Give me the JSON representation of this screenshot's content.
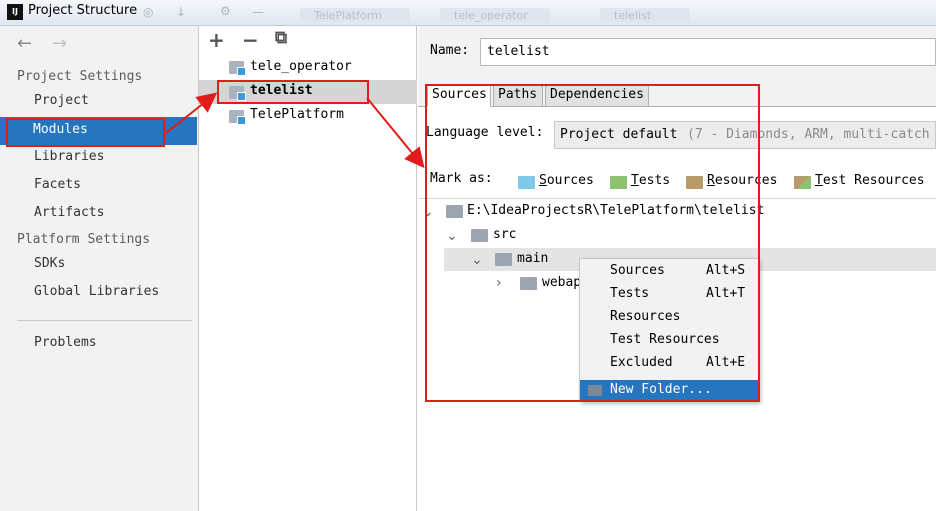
{
  "window": {
    "title": "Project Structure",
    "app_icon": "IJ",
    "ghost_tabs": [
      "TelePlatform",
      "tele_operator",
      "telelist"
    ]
  },
  "nav": {
    "back": "←",
    "forward": "→",
    "project_settings_header": "Project Settings",
    "items": [
      "Project",
      "Modules",
      "Libraries",
      "Facets",
      "Artifacts"
    ],
    "platform_settings_header": "Platform Settings",
    "platform_items": [
      "SDKs",
      "Global Libraries"
    ],
    "problems": "Problems"
  },
  "modules": {
    "add": "+",
    "remove": "−",
    "copy": "⧉",
    "list": [
      "tele_operator",
      "telelist",
      "TelePlatform"
    ]
  },
  "detail": {
    "name_label": "Name:",
    "name_value": "telelist",
    "tabs": [
      "Sources",
      "Paths",
      "Dependencies"
    ],
    "language_label": "Language level:",
    "language_value": "Project default",
    "language_hint": "(7 - Diamonds, ARM, multi-catch",
    "mark_as_label": "Mark as:",
    "mark_as": [
      "Sources",
      "Tests",
      "Resources",
      "Test Resources"
    ],
    "mark_as_mnemonics": [
      "S",
      "T",
      "R",
      "T"
    ],
    "tree": {
      "root": "E:\\IdeaProjectsR\\TelePlatform\\telelist",
      "src": "src",
      "main": "main",
      "webapp": "webap"
    }
  },
  "context_menu": {
    "items": [
      {
        "label": "Sources",
        "shortcut": "Alt+S"
      },
      {
        "label": "Tests",
        "shortcut": "Alt+T"
      },
      {
        "label": "Resources",
        "shortcut": ""
      },
      {
        "label": "Test Resources",
        "shortcut": ""
      },
      {
        "label": "Excluded",
        "shortcut": "Alt+E"
      },
      {
        "label": "New Folder...",
        "shortcut": ""
      }
    ]
  },
  "colors": {
    "selection": "#2675bf",
    "annotation": "#e21b1b",
    "sources_folder": "#7ec8e8",
    "tests_folder": "#8dc26f",
    "resources_folder": "#b89b6b"
  }
}
